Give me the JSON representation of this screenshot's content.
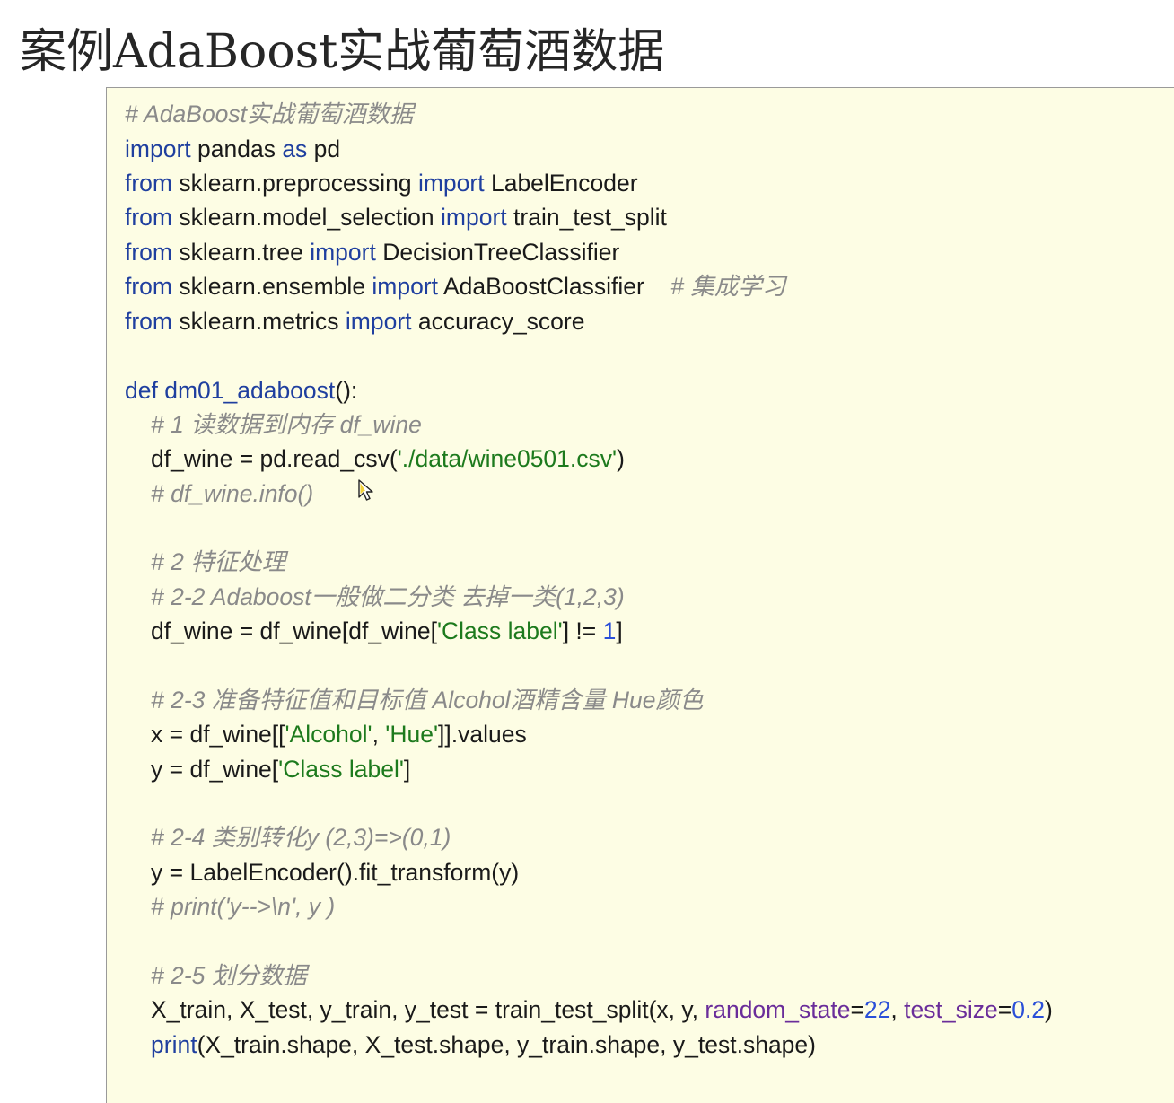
{
  "title": "案例AdaBoost实战葡萄酒数据",
  "code": {
    "l01_comment": "# AdaBoost实战葡萄酒数据",
    "l02_import": "import",
    "l02_mod": " pandas ",
    "l02_as": "as",
    "l02_alias": " pd",
    "l03_from": "from",
    "l03_mod": " sklearn.preprocessing ",
    "l03_import": "import",
    "l03_name": " LabelEncoder",
    "l04_from": "from",
    "l04_mod": " sklearn.model_selection ",
    "l04_import": "import",
    "l04_name": " train_test_split",
    "l05_from": "from",
    "l05_mod": " sklearn.tree ",
    "l05_import": "import",
    "l05_name": " DecisionTreeClassifier",
    "l06_from": "from",
    "l06_mod": " sklearn.ensemble ",
    "l06_import": "import",
    "l06_name": " AdaBoostClassifier    ",
    "l06_comment": "# 集成学习",
    "l07_from": "from",
    "l07_mod": " sklearn.metrics ",
    "l07_import": "import",
    "l07_name": " accuracy_score",
    "l09_def": "def",
    "l09_fname": " dm01_adaboost",
    "l09_rest": "():",
    "l10_comment": "# 1 读数据到内存 df_wine",
    "l11_a": "df_wine = pd.read_csv(",
    "l11_str": "'./data/wine0501.csv'",
    "l11_b": ")",
    "l12_comment": "# df_wine.info()",
    "l14_comment": "# 2 特征处理",
    "l15_comment": "# 2-2 Adaboost一般做二分类 去掉一类(1,2,3)",
    "l16_a": "df_wine = df_wine[df_wine[",
    "l16_str": "'Class label'",
    "l16_b": "] != ",
    "l16_num": "1",
    "l16_c": "]",
    "l18_comment": "# 2-3 准备特征值和目标值 Alcohol酒精含量 Hue颜色",
    "l19_a": "x = df_wine[[",
    "l19_str1": "'Alcohol'",
    "l19_b": ", ",
    "l19_str2": "'Hue'",
    "l19_c": "]].values",
    "l20_a": "y = df_wine[",
    "l20_str": "'Class label'",
    "l20_b": "]",
    "l22_comment": "# 2-4 类别转化y (2,3)=>(0,1)",
    "l23_a": "y = LabelEncoder().fit_transform(y)",
    "l24_comment": "# print('y-->\\n', y )",
    "l26_comment": "# 2-5 划分数据",
    "l27_a": "X_train, X_test, y_train, y_test = train_test_split(x, y, ",
    "l27_kw1": "random_state",
    "l27_eq1": "=",
    "l27_num1": "22",
    "l27_sep": ", ",
    "l27_kw2": "test_size",
    "l27_eq2": "=",
    "l27_num2": "0.2",
    "l27_end": ")",
    "l28_fn": "print",
    "l28_a": "(X_train.shape, X_test.shape, y_train.shape, y_test.shape)"
  },
  "cursor_icon": "mouse-pointer-icon"
}
